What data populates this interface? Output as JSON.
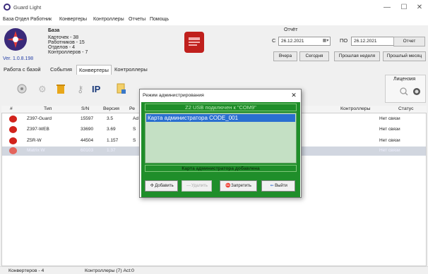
{
  "window": {
    "title": "Guard Light",
    "minimize": "—",
    "maximize": "☐",
    "close": "✕"
  },
  "menu": [
    "База",
    "Отдел",
    "Работник",
    "Конвертеры",
    "Контроллеры",
    "Отчеты",
    "Помощь"
  ],
  "header": {
    "version": "Ver. 1.0.8.198",
    "db_label": "База",
    "stats": [
      "Карточек - 38",
      "Работников - 15",
      "Отделов - 4",
      "Контроллеров - 7"
    ]
  },
  "report": {
    "label": "Отчёт",
    "from_label": "С",
    "to_label": "ПО",
    "date_from": "26.12.2021",
    "date_to": "26.12.2021",
    "report_button": "Отчет",
    "buttons": [
      "Вчера",
      "Сегодня",
      "Прошлая неделя",
      "Прошлый месяц"
    ]
  },
  "tabs": [
    "Работа с базой",
    "События",
    "Конвертеры",
    "Контроллеры"
  ],
  "license": {
    "label": "Лицензия"
  },
  "table": {
    "columns": [
      "#",
      "Тип",
      "S/N",
      "Версия",
      "Ре",
      "Контроллеры",
      "Статус"
    ],
    "rows": [
      {
        "type": "Z397-Guard",
        "sn": "15597",
        "version": "3.5",
        "mode": "Ad",
        "status": "Нет связи"
      },
      {
        "type": "Z397-WEB",
        "sn": "33690",
        "version": "3.69",
        "mode": "S",
        "status": "Нет связи"
      },
      {
        "type": "Z5R-W",
        "sn": "44504",
        "version": "1.157",
        "mode": "S",
        "status": "Нет связи"
      },
      {
        "type": "Matrix W",
        "sn": "60103",
        "version": "1.37",
        "mode": "",
        "status": "Нет связи"
      }
    ]
  },
  "statusbar": {
    "converters": "Конвертеров - 4",
    "controllers": "Контроллеры (7) Act:0"
  },
  "dialog": {
    "title": "Режим администрирования",
    "close": "✕",
    "status": "Z2 USB подключен к \"COM9\"",
    "items": [
      "Карта администратора CODE_001"
    ],
    "message": "Карта администратора добавлена",
    "buttons": {
      "add": "Добавить",
      "delete": "Удалить",
      "forbid": "Запретить",
      "exit": "Выйти"
    }
  },
  "colors": {
    "dialog_green": "#1f8e2a",
    "selection_blue": "#2a6fd0",
    "status_red": "#d2231c"
  }
}
